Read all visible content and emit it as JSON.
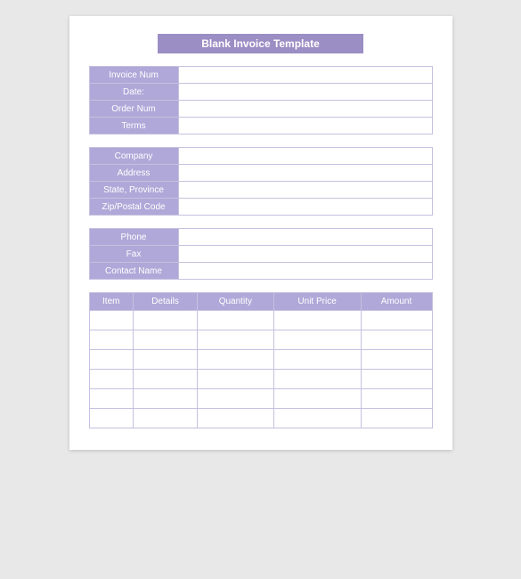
{
  "title": "Blank Invoice Template",
  "section1": {
    "rows": [
      {
        "label": "Invoice Num"
      },
      {
        "label": "Date:"
      },
      {
        "label": "Order Num"
      },
      {
        "label": "Terms"
      }
    ]
  },
  "section2": {
    "rows": [
      {
        "label": "Company"
      },
      {
        "label": "Address"
      },
      {
        "label": "State, Province"
      },
      {
        "label": "Zip/Postal Code"
      }
    ]
  },
  "section3": {
    "rows": [
      {
        "label": "Phone"
      },
      {
        "label": "Fax"
      },
      {
        "label": "Contact Name"
      }
    ]
  },
  "table": {
    "headers": [
      "Item",
      "Details",
      "Quantity",
      "Unit Price",
      "Amount"
    ],
    "row_count": 6
  }
}
